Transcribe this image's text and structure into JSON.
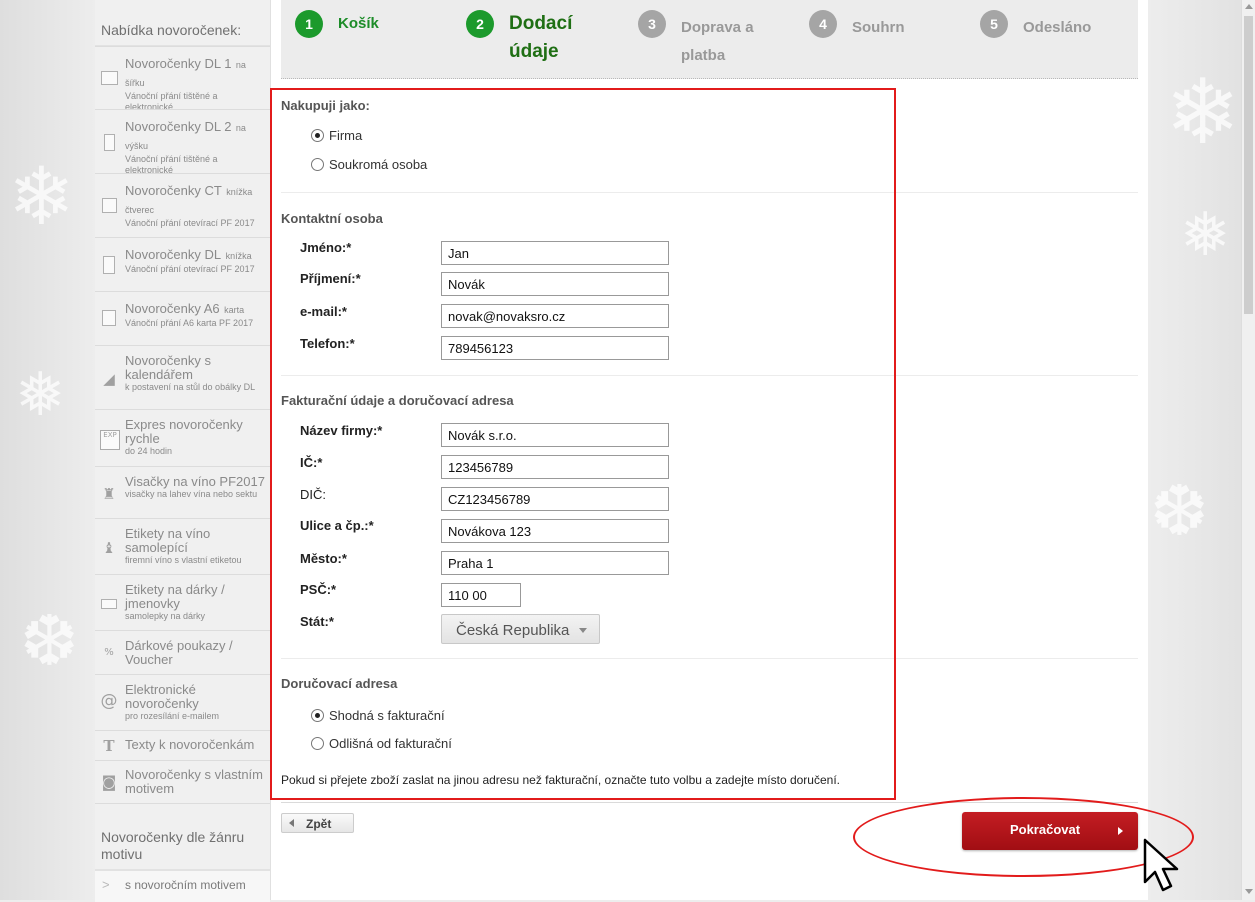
{
  "sidebar": {
    "title": "Nabídka novoročenek:",
    "items": [
      {
        "name": "Novoročenky DL 1",
        "small": "na šířku",
        "desc": "Vánoční přání tištěné a elektronické",
        "icon": "card-landscape-icon"
      },
      {
        "name": "Novoročenky DL 2",
        "small": "na výšku",
        "desc": "Vánoční přání tištěné a elektronické",
        "icon": "card-portrait-icon"
      },
      {
        "name": "Novoročenky CT",
        "small": "knížka čtverec",
        "desc": "Vánoční přání otevírací PF 2017",
        "icon": "square-booklet-icon"
      },
      {
        "name": "Novoročenky DL",
        "small": "knížka",
        "desc": "Vánoční přání otevírací PF 2017",
        "icon": "dl-booklet-icon"
      },
      {
        "name": "Novoročenky A6",
        "small": "karta",
        "desc": "Vánoční přání A6 karta PF 2017",
        "icon": "a6-card-icon"
      },
      {
        "name": "Novoročenky s kalendářem",
        "small": "",
        "desc": "k postavení na stůl do obálky DL",
        "icon": "desk-calendar-icon"
      },
      {
        "name": "Expres novoročenky rychle",
        "small": "",
        "desc": "do 24 hodin",
        "icon": "express-icon"
      },
      {
        "name": "Visačky na víno PF2017",
        "small": "",
        "desc": "visačky na lahev vína nebo sektu",
        "icon": "wine-tag-icon"
      },
      {
        "name": "Etikety na víno samolepící",
        "small": "",
        "desc": "firemní víno s vlastní etiketou",
        "icon": "wine-label-icon"
      },
      {
        "name": "Etikety na dárky / jmenovky",
        "small": "",
        "desc": "samolepky na dárky",
        "icon": "gift-label-icon"
      },
      {
        "name": "Dárkové poukazy / Voucher",
        "small": "",
        "desc": "",
        "icon": "voucher-icon"
      },
      {
        "name": "Elektronické novoročenky",
        "small": "",
        "desc": "pro rozesílání e-mailem",
        "icon": "at-sign-icon"
      },
      {
        "name": "Texty k novoročenkám",
        "small": "",
        "desc": "",
        "icon": "text-icon"
      },
      {
        "name": "Novoročenky s vlastním motivem",
        "small": "",
        "desc": "",
        "icon": "camera-icon"
      }
    ],
    "section2_title": "Novoročenky dle žánru motivu",
    "section2_item": "s novoročním motivem"
  },
  "steps": [
    {
      "num": "1",
      "label": "Košík",
      "state": "done"
    },
    {
      "num": "2",
      "label": "Dodací údaje",
      "state": "active"
    },
    {
      "num": "3",
      "label": "Doprava a platba",
      "state": "pending"
    },
    {
      "num": "4",
      "label": "Souhrn",
      "state": "pending"
    },
    {
      "num": "5",
      "label": "Odesláno",
      "state": "pending"
    }
  ],
  "buyer": {
    "title": "Nakupuji jako:",
    "options": [
      "Firma",
      "Soukromá osoba"
    ],
    "selected": "Firma"
  },
  "contact": {
    "title": "Kontaktní osoba",
    "fields": [
      {
        "label": "Jméno:*",
        "value": "Jan"
      },
      {
        "label": "Příjmení:*",
        "value": "Novák"
      },
      {
        "label": "e-mail:*",
        "value": "novak@novaksro.cz"
      },
      {
        "label": "Telefon:*",
        "value": "789456123"
      }
    ]
  },
  "billing": {
    "title": "Fakturační údaje a doručovací adresa",
    "fields": [
      {
        "label": "Název firmy:*",
        "value": "Novák s.r.o."
      },
      {
        "label": "IČ:*",
        "value": "123456789"
      },
      {
        "label": "DIČ:",
        "value": "CZ123456789"
      },
      {
        "label": "Ulice a čp.:*",
        "value": "Novákova 123"
      },
      {
        "label": "Město:*",
        "value": "Praha 1"
      },
      {
        "label": "PSČ:*",
        "value": "110 00"
      }
    ],
    "country_label": "Stát:*",
    "country_value": "Česká Republika"
  },
  "delivery": {
    "title": "Doručovací adresa",
    "options": [
      "Shodná s fakturační",
      "Odlišná od fakturační"
    ],
    "selected": "Shodná s fakturační",
    "note": "Pokud si přejete zboží zaslat na jinou adresu než fakturační, označte tuto volbu a zadejte místo doručení."
  },
  "buttons": {
    "back": "Zpět",
    "next": "Pokračovat"
  },
  "colors": {
    "accent_green": "#1c9a2c",
    "highlight_red": "#e21b1b",
    "button_red": "#b3141a"
  }
}
